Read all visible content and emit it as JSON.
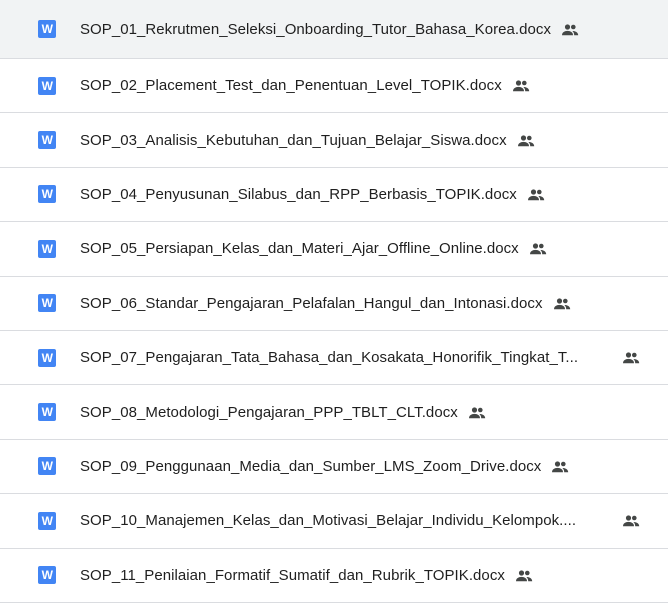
{
  "files": [
    {
      "name": "SOP_01_Rekrutmen_Seleksi_Onboarding_Tutor_Bahasa_Korea.docx",
      "truncated": false,
      "icon": "word-doc-icon",
      "shared_icon": "shared-people-icon"
    },
    {
      "name": "SOP_02_Placement_Test_dan_Penentuan_Level_TOPIK.docx",
      "truncated": false,
      "icon": "word-doc-icon",
      "shared_icon": "shared-people-icon"
    },
    {
      "name": "SOP_03_Analisis_Kebutuhan_dan_Tujuan_Belajar_Siswa.docx",
      "truncated": false,
      "icon": "word-doc-icon",
      "shared_icon": "shared-people-icon"
    },
    {
      "name": "SOP_04_Penyusunan_Silabus_dan_RPP_Berbasis_TOPIK.docx",
      "truncated": false,
      "icon": "word-doc-icon",
      "shared_icon": "shared-people-icon"
    },
    {
      "name": "SOP_05_Persiapan_Kelas_dan_Materi_Ajar_Offline_Online.docx",
      "truncated": false,
      "icon": "word-doc-icon",
      "shared_icon": "shared-people-icon"
    },
    {
      "name": "SOP_06_Standar_Pengajaran_Pelafalan_Hangul_dan_Intonasi.docx",
      "truncated": false,
      "icon": "word-doc-icon",
      "shared_icon": "shared-people-icon"
    },
    {
      "name": "SOP_07_Pengajaran_Tata_Bahasa_dan_Kosakata_Honorifik_Tingkat_T...",
      "truncated": true,
      "icon": "word-doc-icon",
      "shared_icon": "shared-people-icon"
    },
    {
      "name": "SOP_08_Metodologi_Pengajaran_PPP_TBLT_CLT.docx",
      "truncated": false,
      "icon": "word-doc-icon",
      "shared_icon": "shared-people-icon"
    },
    {
      "name": "SOP_09_Penggunaan_Media_dan_Sumber_LMS_Zoom_Drive.docx",
      "truncated": false,
      "icon": "word-doc-icon",
      "shared_icon": "shared-people-icon"
    },
    {
      "name": "SOP_10_Manajemen_Kelas_dan_Motivasi_Belajar_Individu_Kelompok....",
      "truncated": true,
      "icon": "word-doc-icon",
      "shared_icon": "shared-people-icon"
    },
    {
      "name": "SOP_11_Penilaian_Formatif_Sumatif_dan_Rubrik_TOPIK.docx",
      "truncated": false,
      "icon": "word-doc-icon",
      "shared_icon": "shared-people-icon"
    }
  ],
  "icon_letter": "W",
  "colors": {
    "word_blue": "#4285f4",
    "text": "#1f1f1f",
    "divider": "#dadce0",
    "shared_icon": "#444746"
  }
}
